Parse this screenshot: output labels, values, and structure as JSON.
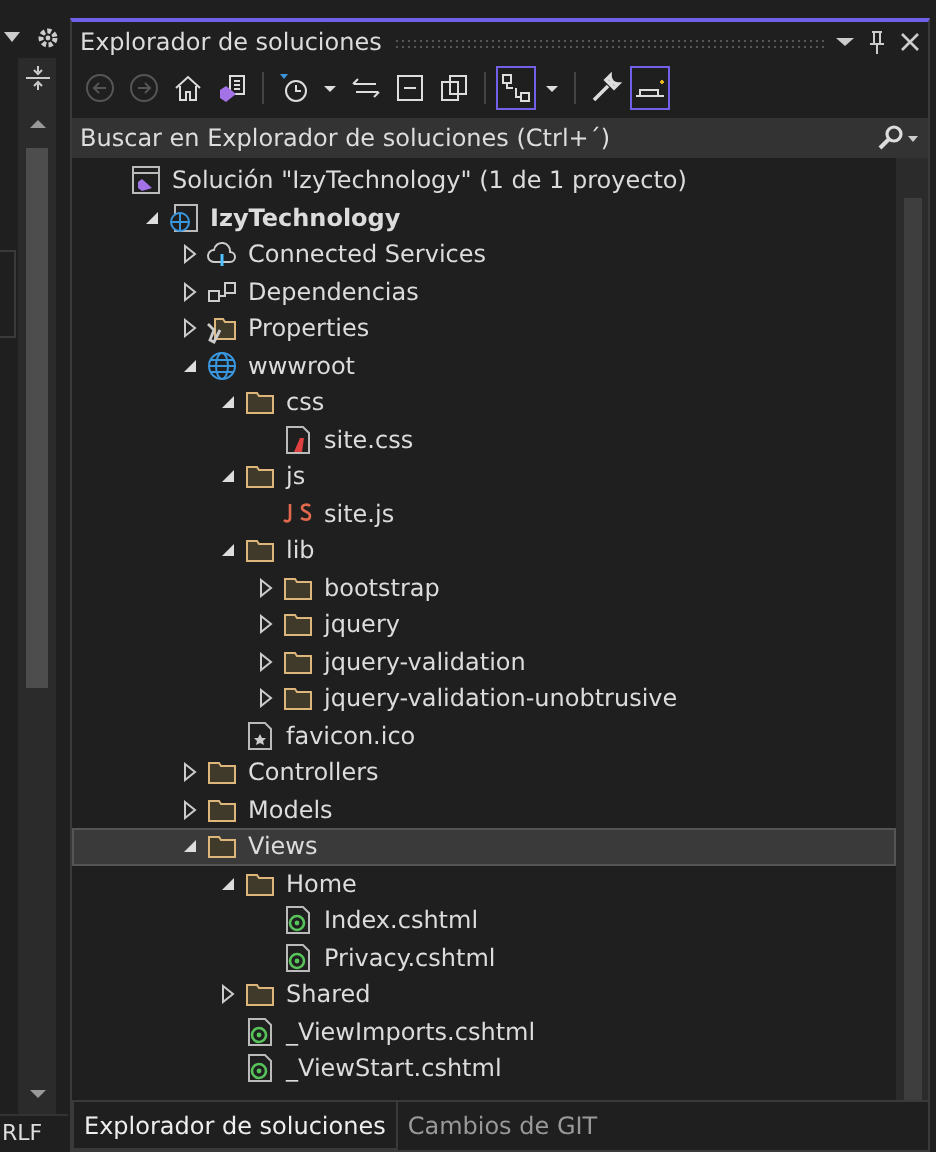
{
  "editor": {
    "status": "RLF"
  },
  "panel": {
    "title": "Explorador de soluciones",
    "search": {
      "placeholder": "Buscar en Explorador de soluciones (Ctrl+´)"
    },
    "toolbar": [
      {
        "kind": "back",
        "disabled": true
      },
      {
        "kind": "forward",
        "disabled": true
      },
      {
        "kind": "home",
        "disabled": false
      },
      {
        "kind": "switch-view",
        "disabled": false
      },
      {
        "kind": "sep"
      },
      {
        "kind": "pending",
        "disabled": false
      },
      {
        "kind": "dropdown",
        "disabled": false
      },
      {
        "kind": "sync",
        "disabled": false
      },
      {
        "kind": "collapse",
        "disabled": false
      },
      {
        "kind": "copies",
        "disabled": false
      },
      {
        "kind": "sep"
      },
      {
        "kind": "hierarchy",
        "disabled": false,
        "on": true
      },
      {
        "kind": "dropdown",
        "disabled": false
      },
      {
        "kind": "sep"
      },
      {
        "kind": "wrench",
        "disabled": false
      },
      {
        "kind": "preview",
        "disabled": false,
        "on": true
      }
    ],
    "tree": [
      {
        "kind": "solution",
        "label": "Solución \"IzyTechnology\"  (1 de 1 proyecto)",
        "selected": false,
        "children": [
          {
            "kind": "project",
            "label": "IzyTechnology",
            "expanded": true,
            "selected": false,
            "children": [
              {
                "kind": "cloud",
                "label": "Connected Services",
                "expanded": false,
                "selected": false
              },
              {
                "kind": "deps",
                "label": "Dependencias",
                "expanded": false,
                "selected": false
              },
              {
                "kind": "properties",
                "label": "Properties",
                "expanded": false,
                "selected": false
              },
              {
                "kind": "globe",
                "label": "wwwroot",
                "expanded": true,
                "selected": false,
                "children": [
                  {
                    "kind": "folder",
                    "label": "css",
                    "expanded": true,
                    "selected": false,
                    "children": [
                      {
                        "kind": "css",
                        "label": "site.css",
                        "selected": false
                      }
                    ]
                  },
                  {
                    "kind": "folder",
                    "label": "js",
                    "expanded": true,
                    "selected": false,
                    "children": [
                      {
                        "kind": "js",
                        "label": "site.js",
                        "selected": false
                      }
                    ]
                  },
                  {
                    "kind": "folder",
                    "label": "lib",
                    "expanded": true,
                    "selected": false,
                    "children": [
                      {
                        "kind": "folder",
                        "label": "bootstrap",
                        "expanded": false,
                        "selected": false
                      },
                      {
                        "kind": "folder",
                        "label": "jquery",
                        "expanded": false,
                        "selected": false
                      },
                      {
                        "kind": "folder",
                        "label": "jquery-validation",
                        "expanded": false,
                        "selected": false
                      },
                      {
                        "kind": "folder",
                        "label": "jquery-validation-unobtrusive",
                        "expanded": false,
                        "selected": false
                      }
                    ]
                  },
                  {
                    "kind": "ico",
                    "label": "favicon.ico",
                    "selected": false
                  }
                ]
              },
              {
                "kind": "folder",
                "label": "Controllers",
                "expanded": false,
                "selected": false
              },
              {
                "kind": "folder",
                "label": "Models",
                "expanded": false,
                "selected": false
              },
              {
                "kind": "folder",
                "label": "Views",
                "expanded": true,
                "selected": true,
                "children": [
                  {
                    "kind": "folder",
                    "label": "Home",
                    "expanded": true,
                    "selected": false,
                    "children": [
                      {
                        "kind": "razor",
                        "label": "Index.cshtml",
                        "selected": false
                      },
                      {
                        "kind": "razor",
                        "label": "Privacy.cshtml",
                        "selected": false
                      }
                    ]
                  },
                  {
                    "kind": "folder",
                    "label": "Shared",
                    "expanded": false,
                    "selected": false
                  },
                  {
                    "kind": "razor",
                    "label": "_ViewImports.cshtml",
                    "selected": false
                  },
                  {
                    "kind": "razor",
                    "label": "_ViewStart.cshtml",
                    "selected": false
                  }
                ]
              }
            ]
          }
        ]
      }
    ],
    "tabs": [
      {
        "label": "Explorador de soluciones",
        "selected": true
      },
      {
        "label": "Cambios de GIT",
        "selected": false
      }
    ]
  }
}
